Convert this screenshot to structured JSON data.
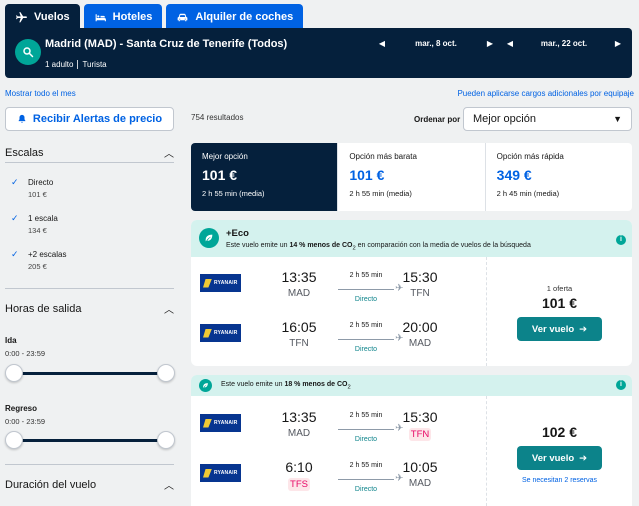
{
  "tabs": [
    {
      "label": "Vuelos",
      "icon": "plane-icon",
      "active": true
    },
    {
      "label": "Hoteles",
      "icon": "bed-icon",
      "active": false
    },
    {
      "label": "Alquiler de coches",
      "icon": "car-icon",
      "active": false
    }
  ],
  "search": {
    "route": "Madrid (MAD) - Santa Cruz de Tenerife (Todos)",
    "passengers": "1 adulto",
    "cabin": "Turista",
    "outbound_date": "mar., 8 oct.",
    "return_date": "mar., 22 oct."
  },
  "links": {
    "show_month": "Mostrar todo el mes",
    "extra_fees": "Pueden aplicarse cargos adicionales por equipaje"
  },
  "sidebar": {
    "price_alerts": "Recibir Alertas de precio",
    "stops_title": "Escalas",
    "stops": [
      {
        "label": "Directo",
        "price": "101 €"
      },
      {
        "label": "1 escala",
        "price": "134 €"
      },
      {
        "label": "+2 escalas",
        "price": "205 €"
      }
    ],
    "times_title": "Horas de salida",
    "outbound_label": "Ida",
    "outbound_range": "0:00 - 23:59",
    "return_label": "Regreso",
    "return_range": "0:00 - 23:59",
    "duration_title": "Duración del vuelo"
  },
  "results": {
    "count": "754 resultados",
    "sort_label": "Ordenar por",
    "sort_value": "Mejor opción"
  },
  "summary": [
    {
      "label": "Mejor opción",
      "price": "101 €",
      "duration": "2 h 55 min (media)"
    },
    {
      "label": "Opción más barata",
      "price": "101 €",
      "duration": "2 h 55 min (media)"
    },
    {
      "label": "Opción más rápida",
      "price": "349 €",
      "duration": "2 h 45 min (media)"
    }
  ],
  "cards": [
    {
      "eco_title": "+Eco",
      "eco_pre": "Este vuelo emite un ",
      "eco_pct": "14 % menos de CO",
      "eco_sub": "2",
      "eco_post": " en comparación con la media de vuelos de la búsqueda",
      "airline": "RYANAIR",
      "legs": [
        {
          "dep_time": "13:35",
          "dep_ap": "MAD",
          "duration": "2 h 55 min",
          "stops": "Directo",
          "arr_time": "15:30",
          "arr_ap": "TFN"
        },
        {
          "dep_time": "16:05",
          "dep_ap": "TFN",
          "duration": "2 h 55 min",
          "stops": "Directo",
          "arr_time": "20:00",
          "arr_ap": "MAD"
        }
      ],
      "offers": "1 oferta",
      "price": "101 €",
      "button": "Ver vuelo"
    },
    {
      "eco_pre": "Este vuelo emite un ",
      "eco_pct": "18 % menos de CO",
      "eco_sub": "2",
      "airline": "RYANAIR",
      "legs": [
        {
          "dep_time": "13:35",
          "dep_ap": "MAD",
          "duration": "2 h 55 min",
          "stops": "Directo",
          "arr_time": "15:30",
          "arr_ap": "TFN"
        },
        {
          "dep_time": "6:10",
          "dep_ap": "TFS",
          "duration": "2 h 55 min",
          "stops": "Directo",
          "arr_time": "10:05",
          "arr_ap": "MAD"
        }
      ],
      "price": "102 €",
      "button": "Ver vuelo",
      "note": "Se necesitan 2 reservas"
    }
  ],
  "colors": {
    "navy": "#05203c",
    "blue": "#0062e3",
    "teal": "#0c838a",
    "eco_bg": "#d4f2ee",
    "warn": "#e70866"
  }
}
